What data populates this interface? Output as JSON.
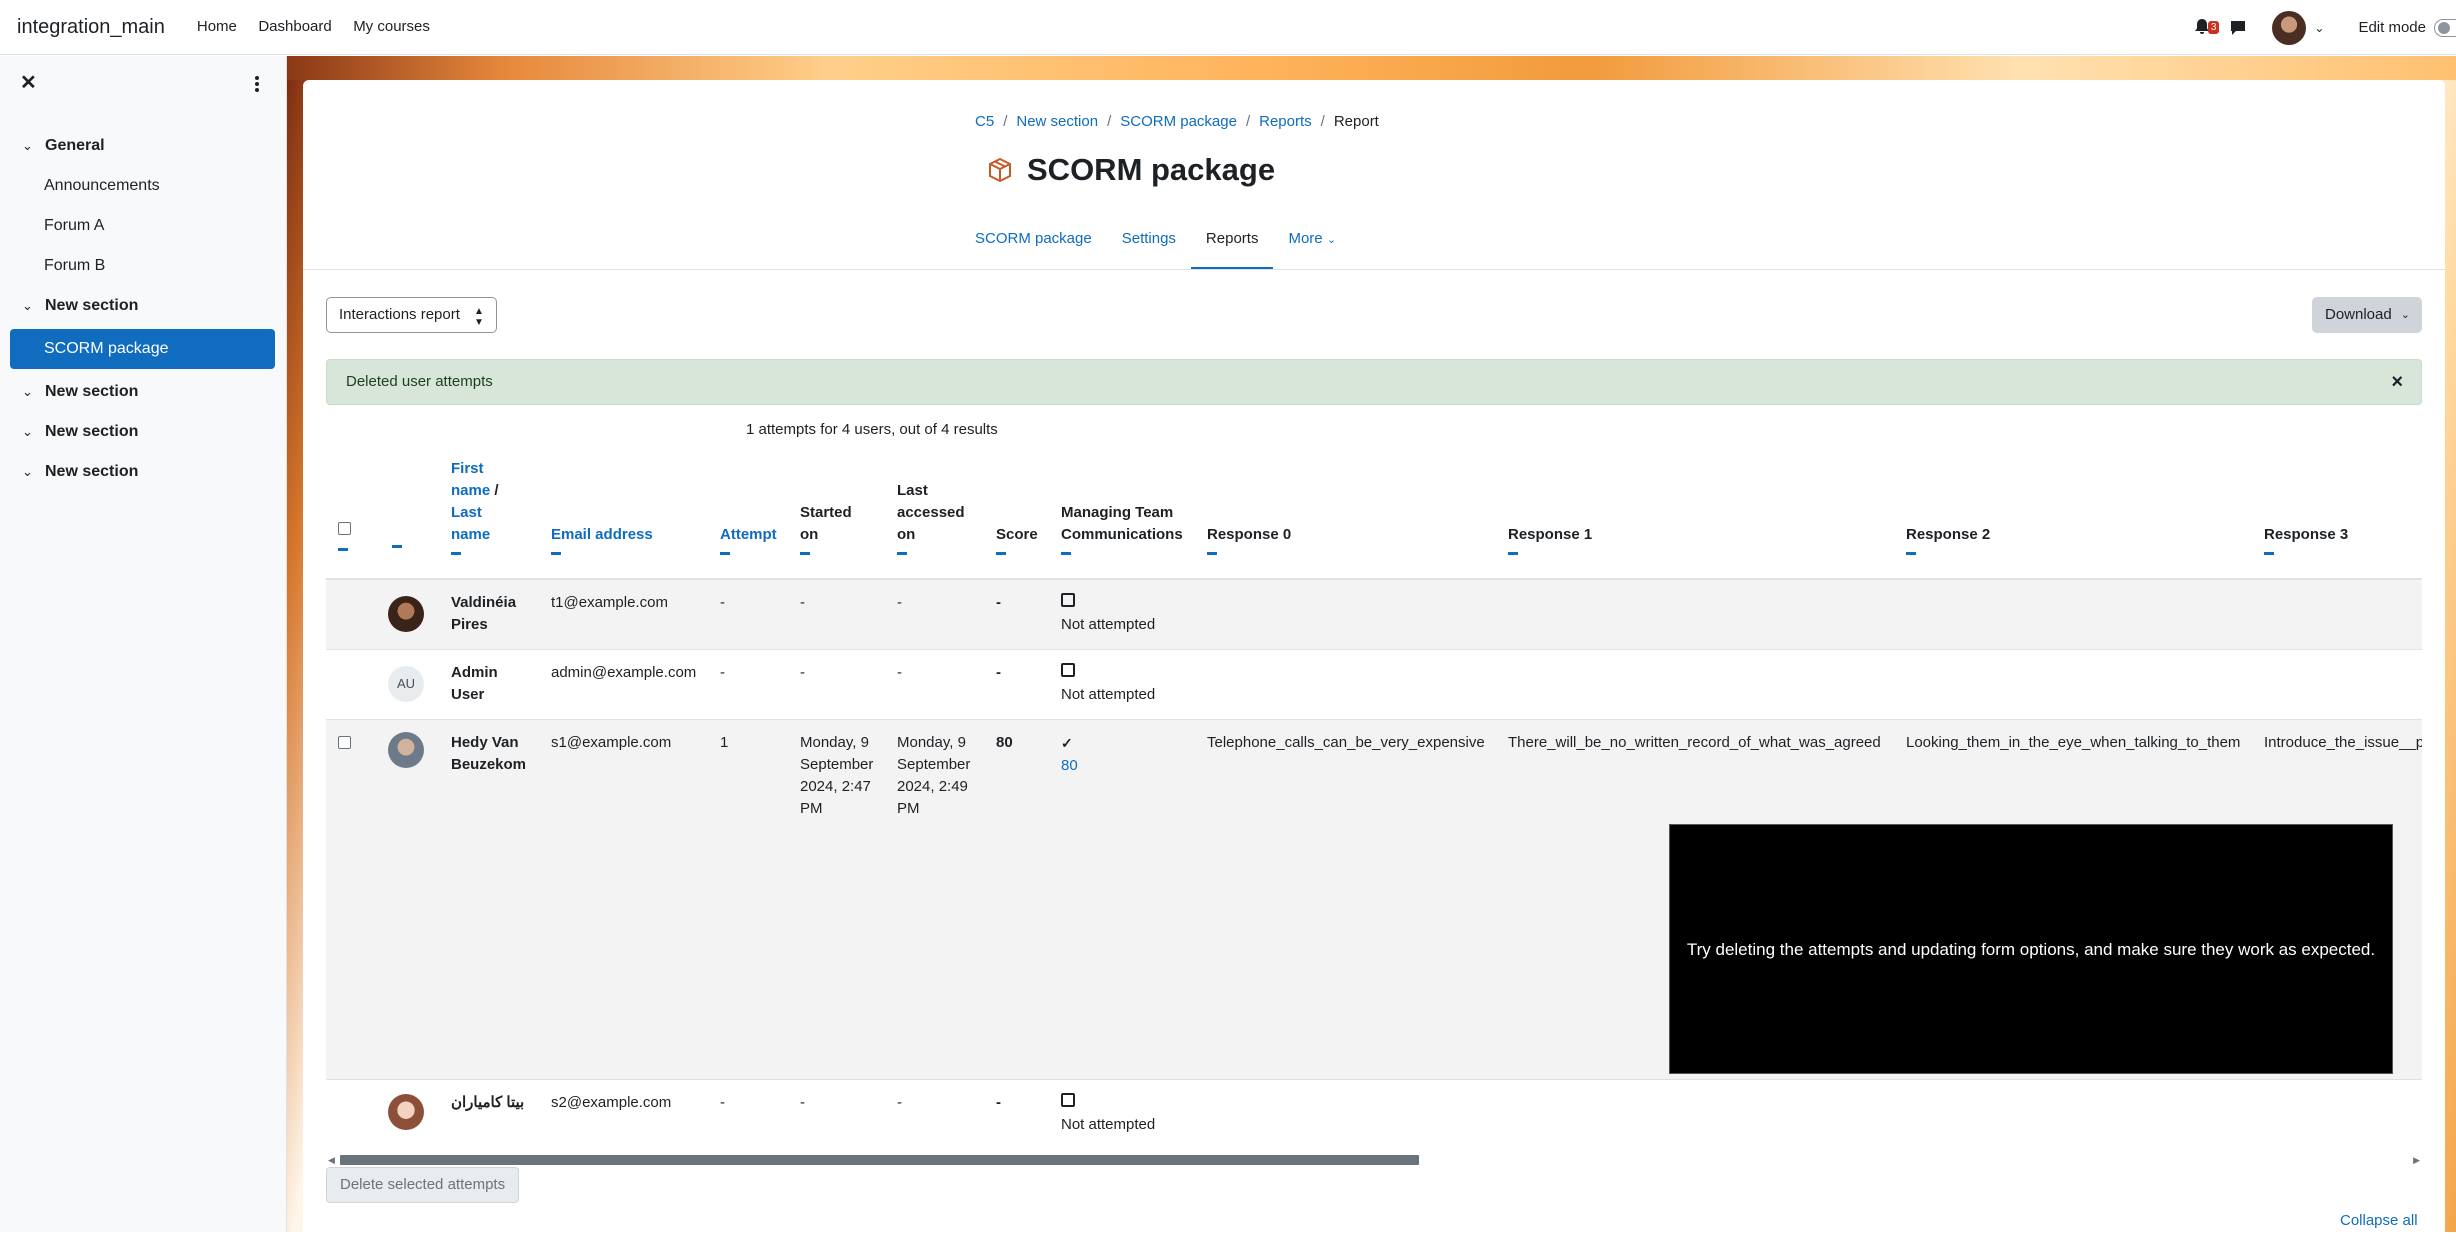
{
  "navbar": {
    "site_name": "integration_main",
    "links": [
      "Home",
      "Dashboard",
      "My courses"
    ],
    "notification_count": "3",
    "edit_mode_label": "Edit mode"
  },
  "drawer": {
    "sections": [
      {
        "title": "General",
        "items": [
          "Announcements",
          "Forum A",
          "Forum B"
        ]
      },
      {
        "title": "New section",
        "items": [
          "SCORM package"
        ]
      },
      {
        "title": "New section",
        "items": []
      },
      {
        "title": "New section",
        "items": []
      },
      {
        "title": "New section",
        "items": []
      }
    ],
    "active_item": "SCORM package"
  },
  "breadcrumb": [
    "C5",
    "New section",
    "SCORM package",
    "Reports",
    "Report"
  ],
  "page_title": "SCORM package",
  "tabs": [
    "SCORM package",
    "Settings",
    "Reports",
    "More"
  ],
  "active_tab": "Reports",
  "report_select": "Interactions report",
  "download_label": "Download",
  "alert_text": "Deleted user attempts",
  "summary": "1 attempts for 4 users, out of 4 results",
  "table": {
    "headers": {
      "first_name": "First name",
      "last_name": "Last name",
      "email": "Email address",
      "attempt": "Attempt",
      "started": "Started on",
      "accessed": "Last accessed on",
      "score": "Score",
      "mtc": "Managing Team Communications",
      "r0": "Response 0",
      "r1": "Response 1",
      "r2": "Response 2",
      "r3": "Response 3"
    },
    "rows": [
      {
        "name": "Valdinéia Pires",
        "email": "t1@example.com",
        "attempt": "-",
        "started": "-",
        "accessed": "-",
        "score": "-",
        "status": "Not attempted"
      },
      {
        "name": "Admin User",
        "initials": "AU",
        "email": "admin@example.com",
        "attempt": "-",
        "started": "-",
        "accessed": "-",
        "score": "-",
        "status": "Not attempted"
      },
      {
        "name": "Hedy Van Beuzekom",
        "email": "s1@example.com",
        "attempt": "1",
        "started": "Monday, 9 September 2024, 2:47 PM",
        "accessed": "Monday, 9 September 2024, 2:49 PM",
        "score": "80",
        "status": "80",
        "r0": "Telephone_calls_can_be_very_expensive",
        "r1": "There_will_be_no_written_record_of_what_was_agreed",
        "r2": "Looking_them_in_the_eye_when_talking_to_them",
        "r3": "Introduce_the_issue__p"
      },
      {
        "name": "بیتا کامیاران",
        "email": "s2@example.com",
        "attempt": "-",
        "started": "-",
        "accessed": "-",
        "score": "-",
        "status": "Not attempted"
      }
    ]
  },
  "video_text": "Try deleting the attempts and updating form options, and make sure they work as expected.",
  "delete_button": "Delete selected attempts",
  "collapse_all": "Collapse all",
  "colors": {
    "primary": "#0f6cbf",
    "alert_bg": "#d7e6d9",
    "badge": "#ca3120"
  }
}
